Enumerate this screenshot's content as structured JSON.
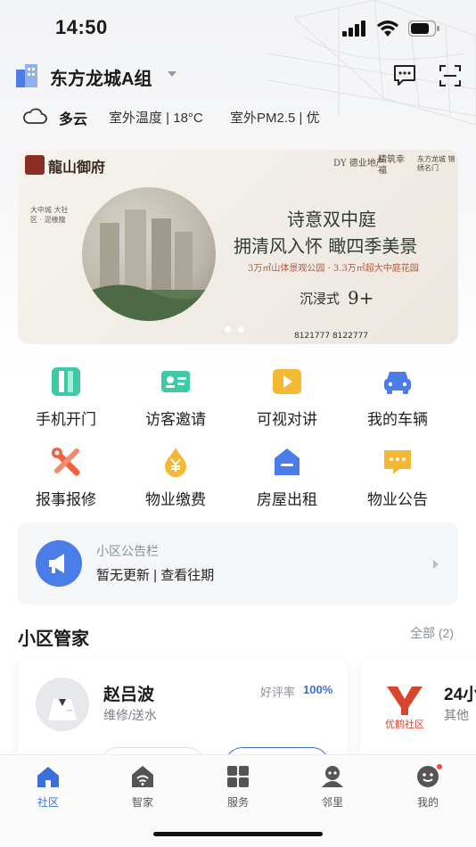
{
  "status_bar": {
    "time": "14:50"
  },
  "header": {
    "community_name": "东方龙城A组"
  },
  "weather": {
    "condition": "多云",
    "outdoor_temp": "室外温度 | 18°C",
    "outdoor_pm": "室外PM2.5 | 优"
  },
  "banner": {
    "logo_text": "龍山御府",
    "brand_1": "DY 德业地产",
    "brand_2": "精筑幸福",
    "brand_3": "东方龙城 锦绣名门",
    "side_text": "大中城 大社区 · 泥楼龍",
    "headline_1": "诗意双中庭",
    "headline_2": "拥清风入怀 瞰四季美景",
    "subline": "3万㎡山体景观公园 · 3.3万㎡超大中庭花园",
    "tag_1": "沉浸式",
    "tag_2": "9+",
    "phone": "8121777 8122777",
    "slides": 2
  },
  "grid": [
    {
      "label": "手机开门",
      "icon": "phone-door-icon",
      "color": "#3ec9a7"
    },
    {
      "label": "访客邀请",
      "icon": "visitor-card-icon",
      "color": "#3ec9a7"
    },
    {
      "label": "可视对讲",
      "icon": "video-intercom-icon",
      "color": "#f5b833"
    },
    {
      "label": "我的车辆",
      "icon": "car-icon",
      "color": "#4b7de8"
    },
    {
      "label": "报事报修",
      "icon": "repair-tools-icon",
      "color": "#f0623e"
    },
    {
      "label": "物业缴费",
      "icon": "yuan-payment-icon",
      "color": "#f5b833"
    },
    {
      "label": "房屋出租",
      "icon": "house-rent-icon",
      "color": "#4b7de8"
    },
    {
      "label": "物业公告",
      "icon": "announcement-chat-icon",
      "color": "#f5b833"
    }
  ],
  "notice": {
    "title": "小区公告栏",
    "body": "暂无更新 | 查看往期"
  },
  "stewards": {
    "title": "小区管家",
    "more": "全部 (2)",
    "cards": [
      {
        "name": "赵吕波",
        "role": "维修/送水",
        "rating_label": "好评率",
        "rating_value": "100%"
      },
      {
        "name": "24小",
        "role": "其他",
        "logo_text": "优鹤社区"
      }
    ]
  },
  "tabbar": {
    "tabs": [
      {
        "label": "社区",
        "icon": "home-icon",
        "active": true
      },
      {
        "label": "智家",
        "icon": "smart-home-icon"
      },
      {
        "label": "服务",
        "icon": "services-grid-icon"
      },
      {
        "label": "邻里",
        "icon": "neighbors-icon"
      },
      {
        "label": "我的",
        "icon": "profile-icon"
      }
    ]
  },
  "colors": {
    "accent": "#3a6fdc",
    "notice_blue": "#4b7de8",
    "badge": "#f04b4b"
  }
}
